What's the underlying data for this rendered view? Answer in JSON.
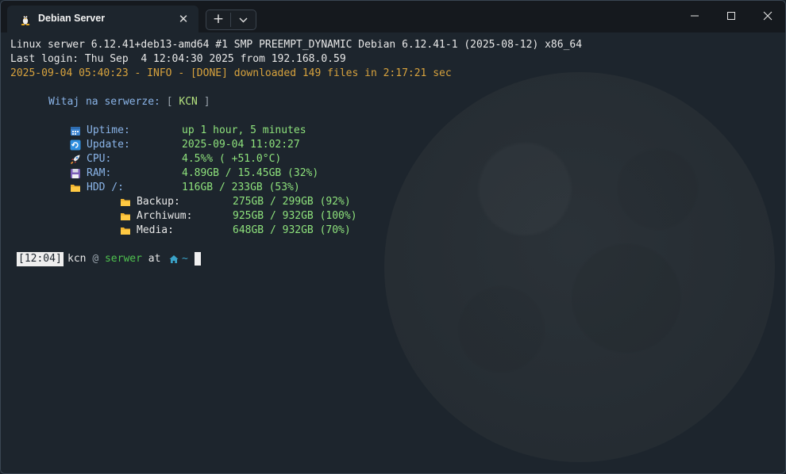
{
  "window": {
    "tab_title": "Debian Server",
    "tab_icon": "linux-penguin-icon",
    "close_tab_glyph": "✕",
    "new_tab_glyph": "+"
  },
  "terminal": {
    "uname": "Linux serwer 6.12.41+deb13-amd64 #1 SMP PREEMPT_DYNAMIC Debian 6.12.41-1 (2025-08-12) x86_64",
    "last_login": "Last login: Thu Sep  4 12:04:30 2025 from 192.168.0.59",
    "log_line": "2025-09-04 05:40:23 - INFO - [DONE] downloaded 149 files in 2:17:21 sec",
    "welcome_label": "Witaj na serwerze:",
    "welcome_open": "[",
    "welcome_user": "KCN",
    "welcome_close": "]",
    "stats": [
      {
        "icon": "calendar-icon",
        "label": "Uptime:",
        "value": "up 1 hour, 5 minutes"
      },
      {
        "icon": "refresh-icon",
        "label": "Update:",
        "value": "2025-09-04 11:02:27"
      },
      {
        "icon": "rocket-icon",
        "label": "CPU:",
        "value": "4.5%% ( +51.0°C)"
      },
      {
        "icon": "floppy-disk-icon",
        "label": "RAM:",
        "value": "4.89GB / 15.45GB (32%)"
      },
      {
        "icon": "folder-icon",
        "label": "HDD /:",
        "value": "116GB / 233GB (53%)"
      }
    ],
    "disks": [
      {
        "icon": "folder-icon",
        "label": "Backup:",
        "value": "275GB / 299GB (92%)"
      },
      {
        "icon": "folder-icon",
        "label": "Archiwum:",
        "value": "925GB / 932GB (100%)"
      },
      {
        "icon": "folder-icon",
        "label": "Media:",
        "value": "648GB / 932GB (70%)"
      }
    ],
    "prompt": {
      "time": "[12:04]",
      "user": "kcn",
      "at_glyph": "@",
      "host": "serwer",
      "at_word": "at",
      "home_icon": "home-icon",
      "path": "~"
    }
  },
  "colors": {
    "background": "#1d252d",
    "titlebar": "#15191e",
    "log_orange": "#d7a23d",
    "label_blue": "#8ab4e8",
    "value_green": "#8ee27c",
    "host_green": "#4fc24f"
  }
}
